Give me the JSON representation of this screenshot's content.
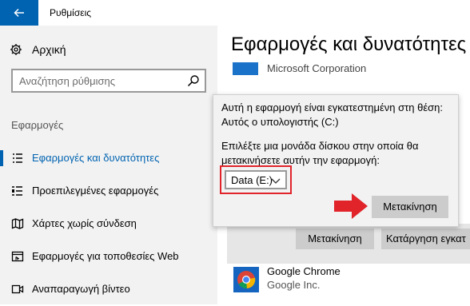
{
  "window": {
    "title": "Ρυθμίσεις"
  },
  "sidebar": {
    "home_label": "Αρχική",
    "search_placeholder": "Αναζήτηση ρύθμισης",
    "section_label": "Εφαρμογές",
    "items": [
      {
        "label": "Εφαρμογές και δυνατότητες",
        "icon": "apps-list-icon",
        "active": true
      },
      {
        "label": "Προεπιλεγμένες εφαρμογές",
        "icon": "default-apps-icon",
        "active": false
      },
      {
        "label": "Χάρτες χωρίς σύνδεση",
        "icon": "offline-maps-icon",
        "active": false
      },
      {
        "label": "Εφαρμογές για τοποθεσίες Web",
        "icon": "websites-apps-icon",
        "active": false
      },
      {
        "label": "Αναπαραγωγή βίντεο",
        "icon": "video-playback-icon",
        "active": false
      }
    ]
  },
  "main": {
    "page_title": "Εφαρμογές και δυνατότητες",
    "top_app_publisher": "Microsoft Corporation",
    "buttons": {
      "move": "Μετακίνηση",
      "uninstall": "Κατάργηση εγκατ"
    },
    "app": {
      "name": "Google Chrome",
      "publisher": "Google Inc."
    }
  },
  "flyout": {
    "line1": "Αυτή η εφαρμογή είναι εγκατεστημένη στη θέση:",
    "line2": "Αυτός ο υπολογιστής (C:)",
    "line3": "Επιλέξτε μια μονάδα δίσκου στην οποία θα",
    "line4": "μετακινήσετε αυτήν την εφαρμογή:",
    "drive_selected": "Data (E:)",
    "move_button": "Μετακίνηση"
  },
  "colors": {
    "accent": "#0063b1",
    "highlight": "#e0242a"
  }
}
